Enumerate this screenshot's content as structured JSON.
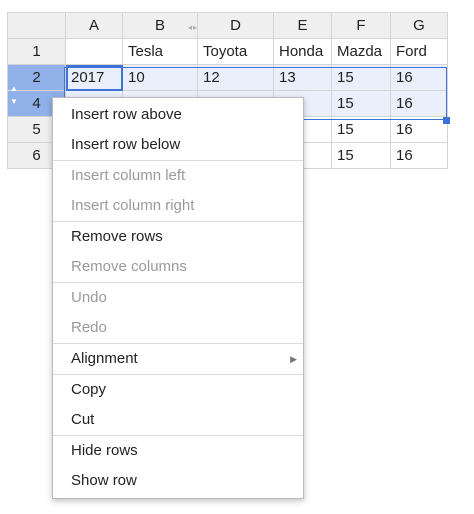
{
  "columns": [
    "A",
    "B",
    "D",
    "E",
    "F",
    "G"
  ],
  "rows": [
    {
      "header": "1",
      "cells": [
        "",
        "Tesla",
        "Toyota",
        "Honda",
        "Mazda",
        "Ford"
      ]
    },
    {
      "header": "2",
      "cells": [
        "2017",
        "10",
        "12",
        "13",
        "15",
        "16"
      ]
    },
    {
      "header": "4",
      "cells": [
        "",
        "",
        "",
        "",
        "15",
        "16"
      ]
    },
    {
      "header": "5",
      "cells": [
        "",
        "",
        "",
        "",
        "15",
        "16"
      ]
    },
    {
      "header": "6",
      "cells": [
        "",
        "",
        "",
        "",
        "15",
        "16"
      ]
    }
  ],
  "row_arrows": {
    "up": "▲",
    "down": "▼"
  },
  "hidden_column_marker": "◂▸",
  "menu": {
    "insert_row_above": "Insert row above",
    "insert_row_below": "Insert row below",
    "insert_column_left": "Insert column left",
    "insert_column_right": "Insert column right",
    "remove_rows": "Remove rows",
    "remove_columns": "Remove columns",
    "undo": "Undo",
    "redo": "Redo",
    "alignment": "Alignment",
    "alignment_arrow": "▶",
    "copy": "Copy",
    "cut": "Cut",
    "hide_rows": "Hide rows",
    "show_row": "Show row"
  },
  "colors": {
    "selection": "#3d73d6",
    "row_header_selected": "#8fb0e8",
    "header_bg": "#efefef"
  }
}
